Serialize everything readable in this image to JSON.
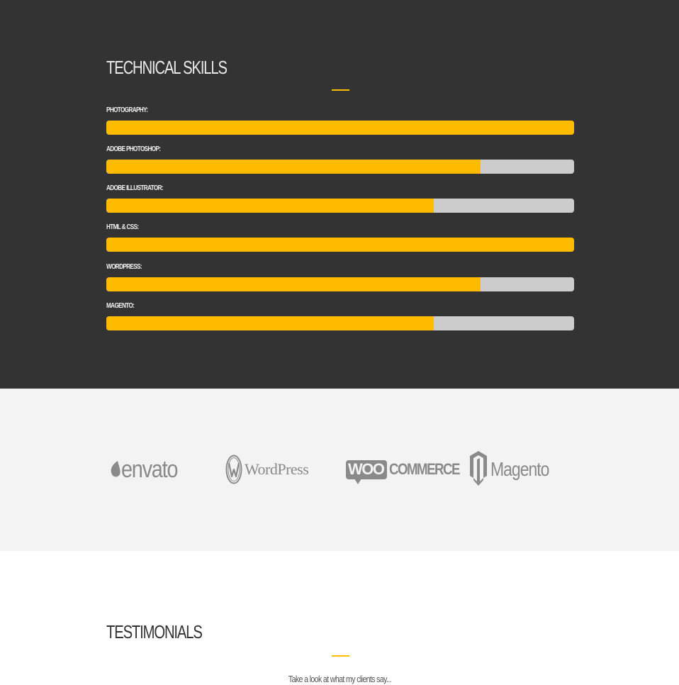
{
  "skills_section": {
    "title": "TECHNICAL SKILLS",
    "accent_color": "#ffbb00",
    "track_color": "#cccccc",
    "background_color": "#333333",
    "skills": [
      {
        "label": "PHOTOGRAPHY:",
        "percent": 100
      },
      {
        "label": "ADOBE PHOTOSHOP:",
        "percent": 80
      },
      {
        "label": "ADOBE ILLUSTRATOR:",
        "percent": 70
      },
      {
        "label": "HTML & CSS:",
        "percent": 100
      },
      {
        "label": "WORDPRESS:",
        "percent": 80
      },
      {
        "label": "MAGENTO:",
        "percent": 70
      }
    ]
  },
  "logos_section": {
    "background_color": "#f3f3f3",
    "logos": [
      {
        "name": "envato",
        "text": "envato",
        "icon": "envato-leaf-icon"
      },
      {
        "name": "wordpress",
        "text": "WordPress",
        "icon": "wordpress-w-icon"
      },
      {
        "name": "woocommerce",
        "badge": "WOO",
        "text": "COMMERCE",
        "icon": "woo-bubble-icon"
      },
      {
        "name": "magento",
        "text": "Magento",
        "icon": "magento-m-icon"
      }
    ]
  },
  "testimonials_section": {
    "title": "TESTIMONIALS",
    "subtitle": "Take a look at what my clients say..."
  }
}
